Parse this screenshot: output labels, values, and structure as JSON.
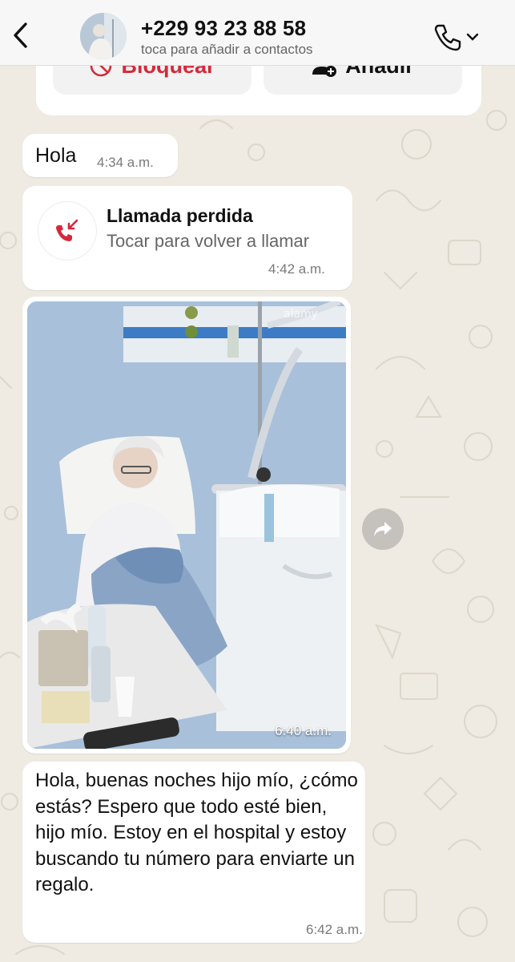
{
  "header": {
    "contact_name": "+229 93 23 88 58",
    "contact_subtitle": "toca para añadir a contactos",
    "back_icon": "chevron-left-icon",
    "call_icon": "phone-icon"
  },
  "actions": {
    "block_label": "Bloquear",
    "add_label": "Añadir",
    "block_color": "#d6283b"
  },
  "messages": [
    {
      "type": "text",
      "text": "Hola",
      "time": "4:34 a.m."
    },
    {
      "type": "missed_call",
      "title": "Llamada perdida",
      "subtitle": "Tocar para volver a llamar",
      "time": "4:42 a.m.",
      "icon_color": "#d6283b"
    },
    {
      "type": "image",
      "time": "6:40 a.m."
    },
    {
      "type": "text",
      "text": "Hola, buenas noches hijo mío, ¿cómo estás? Espero que todo esté bien, hijo mío. Estoy en el hospital y estoy buscando tu número para enviarte un regalo.",
      "time": "6:42 a.m."
    }
  ],
  "colors": {
    "chat_background": "#efeae2",
    "bubble": "#ffffff",
    "timestamp": "#7a7a7a"
  }
}
